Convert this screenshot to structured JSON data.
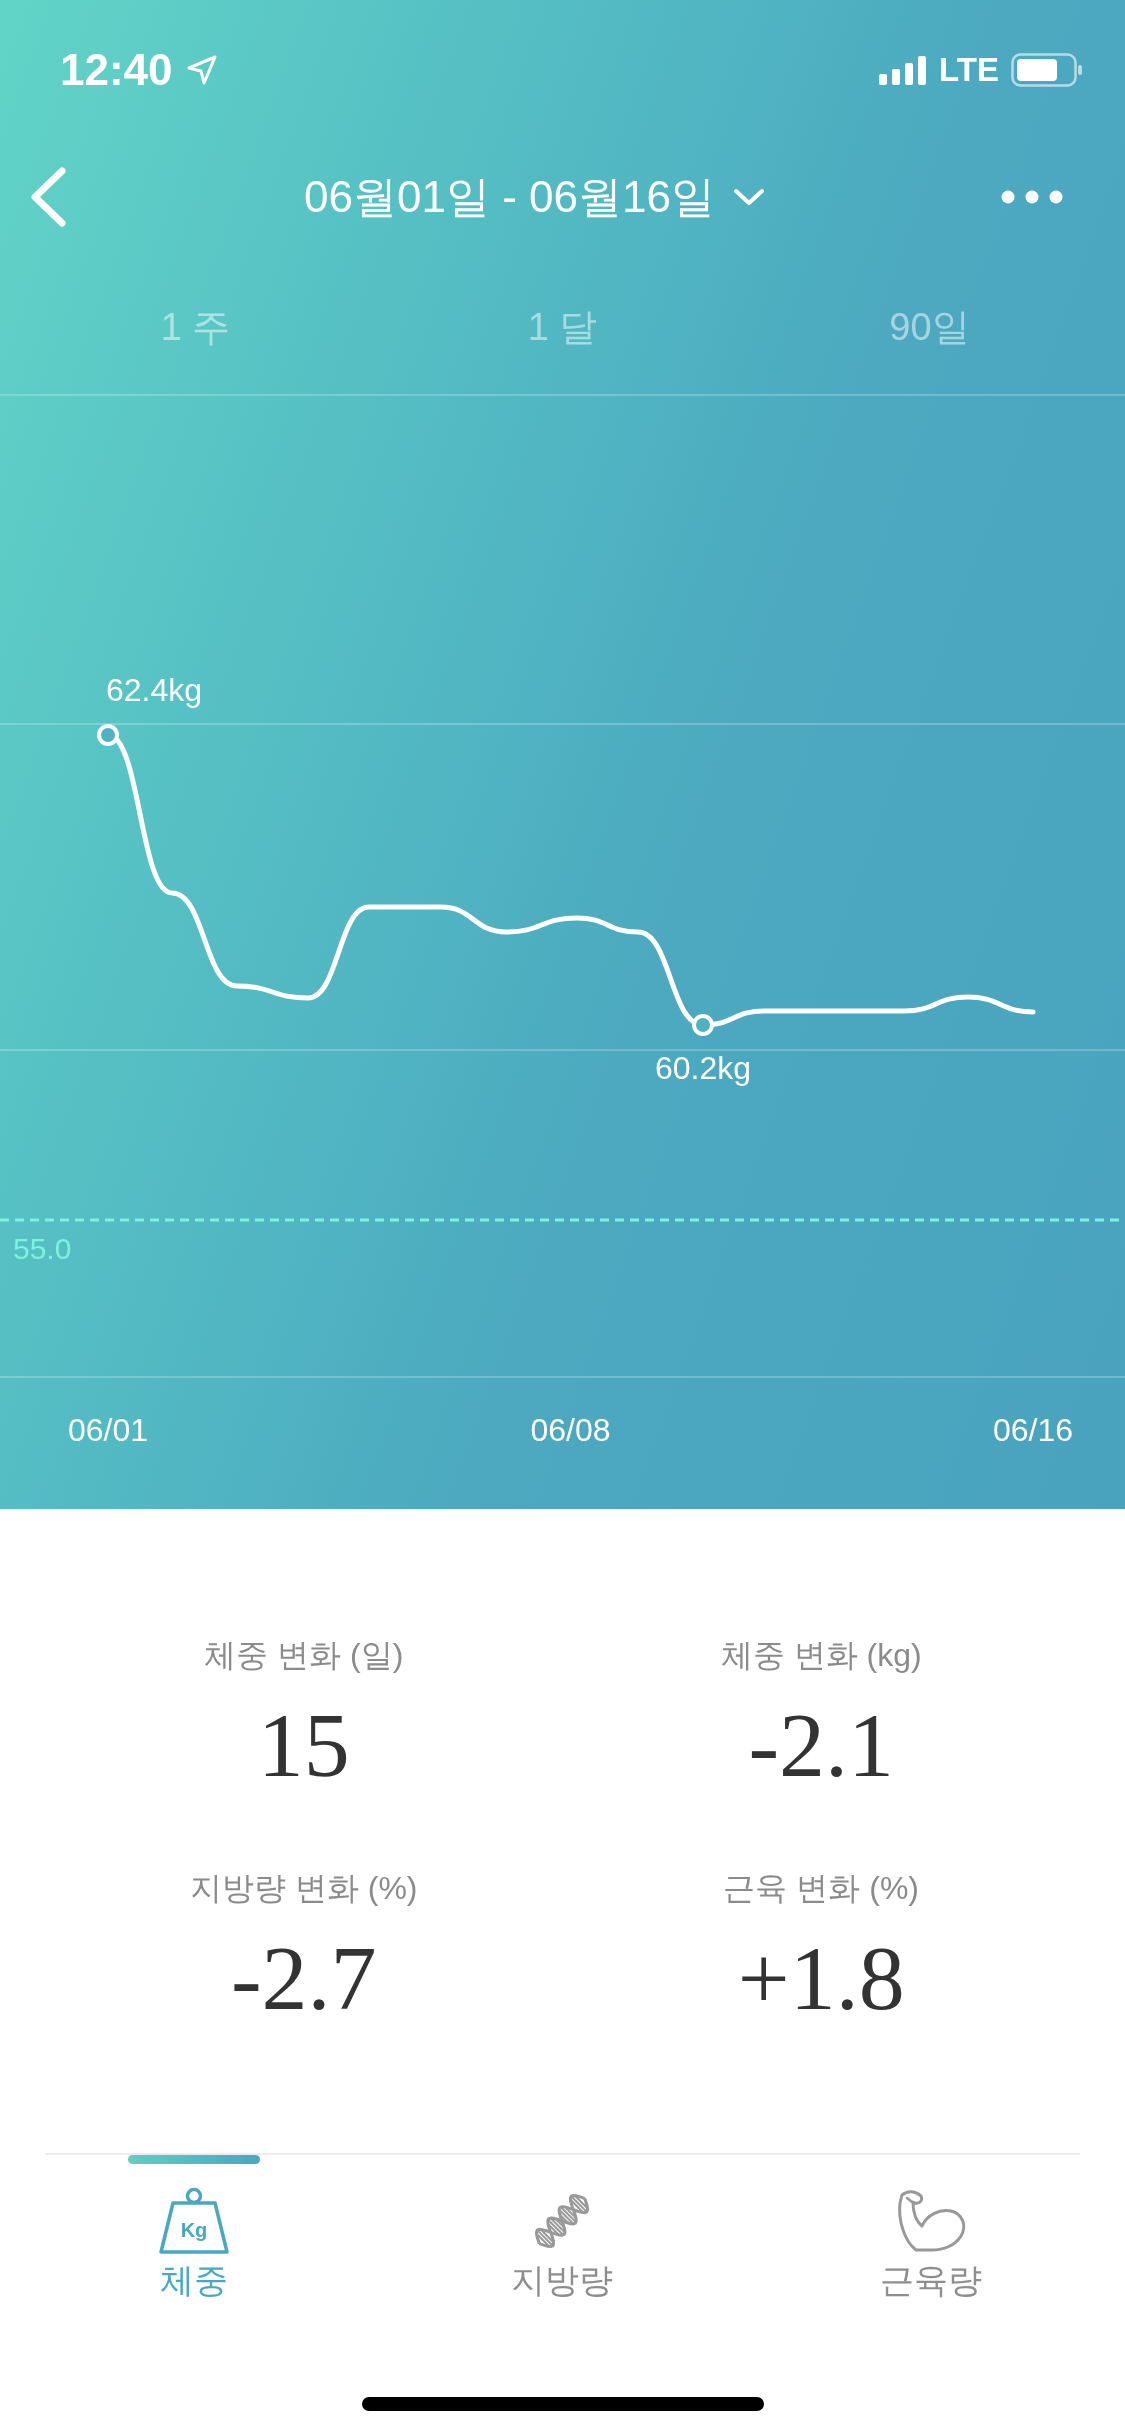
{
  "status_bar": {
    "time": "12:40",
    "network": "LTE"
  },
  "header": {
    "title": "06월01일 - 06월16일"
  },
  "period_tabs": [
    {
      "label": "1 주",
      "selected": false
    },
    {
      "label": "1 달",
      "selected": false
    },
    {
      "label": "90일",
      "selected": false
    }
  ],
  "chart": {
    "point_labels": [
      {
        "text": "62.4kg",
        "kind": "max"
      },
      {
        "text": "60.2kg",
        "kind": "min"
      }
    ],
    "goal_label": "55.0",
    "x_labels": [
      "06/01",
      "06/08",
      "06/16"
    ]
  },
  "stats": [
    {
      "label": "체중 변화 (일)",
      "value": "15"
    },
    {
      "label": "체중 변화 (kg)",
      "value": "-2.1"
    },
    {
      "label": "지방량 변화 (%)",
      "value": "-2.7"
    },
    {
      "label": "근육 변화 (%)",
      "value": "+1.8"
    }
  ],
  "bottom_tabs": [
    {
      "label": "체중",
      "kind": "weight",
      "icon_text": "Kg",
      "selected": true
    },
    {
      "label": "지방량",
      "kind": "fat",
      "selected": false
    },
    {
      "label": "근육량",
      "kind": "muscle",
      "selected": false
    }
  ]
}
